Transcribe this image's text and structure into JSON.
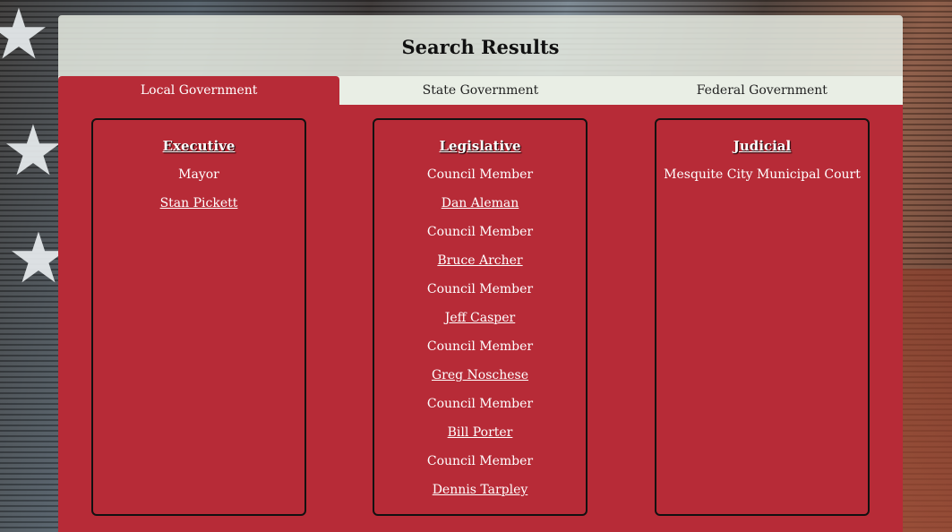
{
  "page_title": "Search Results",
  "tabs": [
    {
      "label": "Local Government",
      "active": true
    },
    {
      "label": "State Government",
      "active": false
    },
    {
      "label": "Federal Government",
      "active": false
    }
  ],
  "branches": {
    "executive": {
      "title": "Executive",
      "entries": [
        {
          "role": "Mayor",
          "name": "Stan Pickett"
        }
      ]
    },
    "legislative": {
      "title": "Legislative",
      "entries": [
        {
          "role": "Council Member",
          "name": "Dan Aleman"
        },
        {
          "role": "Council Member",
          "name": "Bruce Archer"
        },
        {
          "role": "Council Member",
          "name": "Jeff Casper"
        },
        {
          "role": "Council Member",
          "name": "Greg Noschese"
        },
        {
          "role": "Council Member",
          "name": "Bill Porter"
        },
        {
          "role": "Council Member",
          "name": "Dennis Tarpley"
        }
      ]
    },
    "judicial": {
      "title": "Judicial",
      "entries": [
        {
          "role": "Mesquite City Municipal Court"
        }
      ]
    }
  },
  "colors": {
    "panel_red": "#b72b37",
    "tab_bar": "#e9eee5",
    "header_bg": "#e2e7de"
  }
}
